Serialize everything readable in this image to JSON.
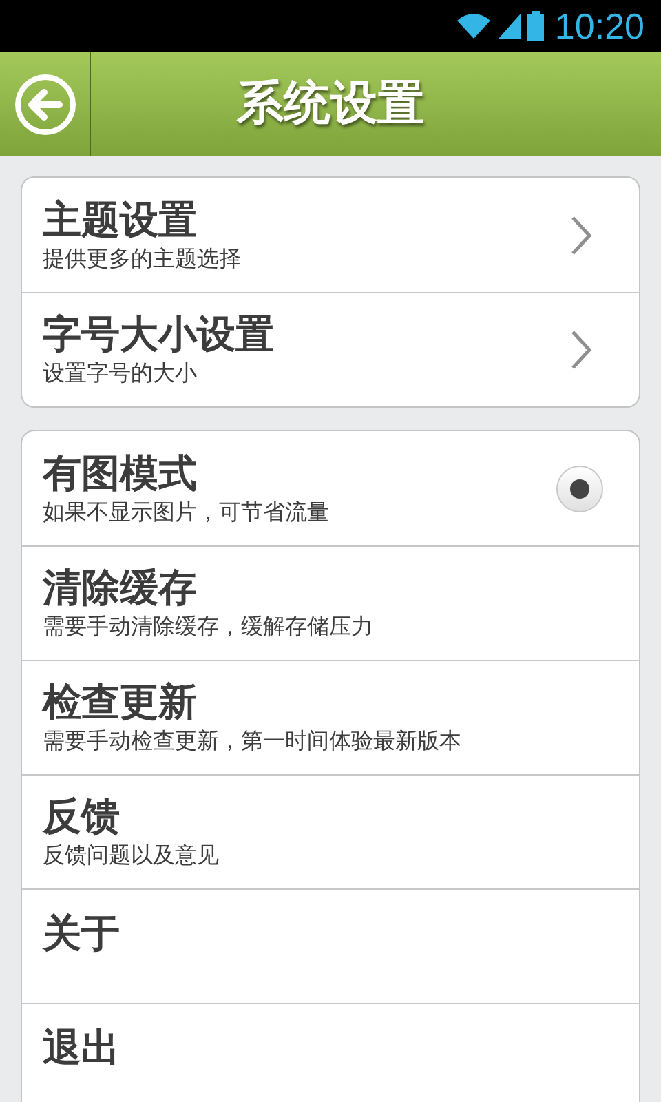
{
  "status_bar": {
    "time": "10:20"
  },
  "header": {
    "title": "系统设置"
  },
  "groups": [
    {
      "items": [
        {
          "kind": "link",
          "title": "主题设置",
          "subtitle": "提供更多的主题选择"
        },
        {
          "kind": "link",
          "title": "字号大小设置",
          "subtitle": "设置字号的大小"
        }
      ]
    },
    {
      "items": [
        {
          "kind": "radio",
          "title": "有图模式",
          "subtitle": "如果不显示图片，可节省流量",
          "checked": true
        },
        {
          "kind": "plain",
          "title": "清除缓存",
          "subtitle": "需要手动清除缓存，缓解存储压力"
        },
        {
          "kind": "plain",
          "title": "检查更新",
          "subtitle": "需要手动检查更新，第一时间体验最新版本"
        },
        {
          "kind": "plain",
          "title": "反馈",
          "subtitle": "反馈问题以及意见"
        },
        {
          "kind": "plain",
          "title": "关于"
        },
        {
          "kind": "plain",
          "title": "退出"
        }
      ]
    }
  ]
}
